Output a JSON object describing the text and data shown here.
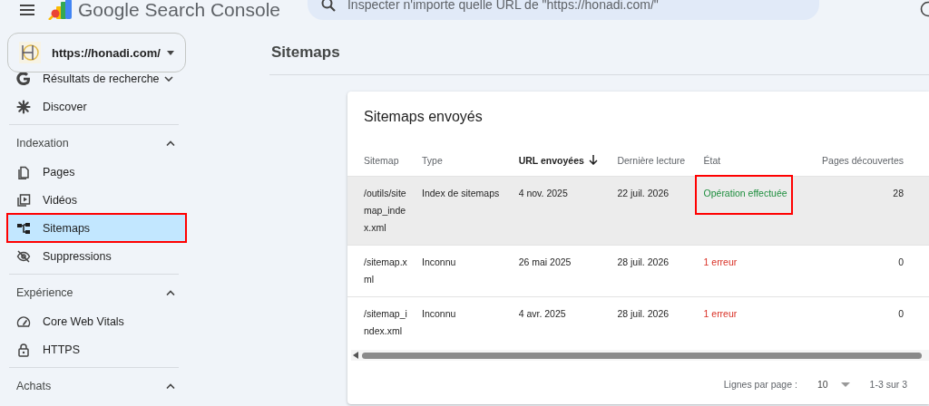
{
  "header": {
    "product": "Google Search Console",
    "search": {
      "placeholder": "Inspecter n'importe quelle URL de \"https://honadi.com/\""
    }
  },
  "sidebar": {
    "property": {
      "url": "https://honadi.com/"
    },
    "groups": [
      {
        "items": [
          {
            "kind": "expander",
            "label": "Résultats de recherche",
            "expanded": false
          },
          {
            "kind": "link",
            "label": "Discover",
            "selected": false,
            "highlighted": false
          }
        ]
      },
      {
        "title": "Indexation",
        "expanded": true,
        "items": [
          {
            "kind": "link",
            "label": "Pages",
            "selected": false,
            "highlighted": false
          },
          {
            "kind": "link",
            "label": "Vidéos",
            "selected": false,
            "highlighted": false
          },
          {
            "kind": "link",
            "label": "Sitemaps",
            "selected": true,
            "highlighted": true
          },
          {
            "kind": "link",
            "label": "Suppressions",
            "selected": false,
            "highlighted": false
          }
        ]
      },
      {
        "title": "Expérience",
        "expanded": true,
        "items": [
          {
            "kind": "link",
            "label": "Core Web Vitals",
            "selected": false,
            "highlighted": false
          },
          {
            "kind": "link",
            "label": "HTTPS",
            "selected": false,
            "highlighted": false
          }
        ]
      },
      {
        "title": "Achats",
        "expanded": true
      }
    ]
  },
  "page_title": "Sitemaps",
  "card": {
    "title": "Sitemaps envoyés",
    "table": {
      "columns": [
        {
          "label": "Sitemap",
          "sorted": false
        },
        {
          "label": "Type",
          "sorted": false
        },
        {
          "label": "URL envoyées",
          "sorted": true
        },
        {
          "label": "Dernière lecture",
          "sorted": false
        },
        {
          "label": "État",
          "sorted": false
        },
        {
          "label": "Pages découvertes",
          "sorted": false
        }
      ],
      "rows": [
        {
          "selected": true,
          "sitemap": "/outils/sitemap_index.xml",
          "type": "Index de sitemaps",
          "submitted": "4 nov. 2025",
          "last_read": "22 juil. 2026",
          "status": {
            "kind": "success",
            "text": "Opération effectuée",
            "highlighted": true
          },
          "discovered": "28"
        },
        {
          "selected": false,
          "sitemap": "/sitemap.xml",
          "type": "Inconnu",
          "submitted": "26 mai 2025",
          "last_read": "28 juil. 2026",
          "status": {
            "kind": "error",
            "text": "1 erreur",
            "highlighted": false
          },
          "discovered": "0"
        },
        {
          "selected": false,
          "sitemap": "/sitemap_index.xml",
          "type": "Inconnu",
          "submitted": "4 avr. 2025",
          "last_read": "28 juil. 2026",
          "status": {
            "kind": "error",
            "text": "1 erreur",
            "highlighted": false
          },
          "discovered": "0"
        }
      ]
    },
    "pagination": {
      "rows_label": "Lignes par page :",
      "rows_value": "10",
      "range": "1-3 sur 3"
    }
  }
}
